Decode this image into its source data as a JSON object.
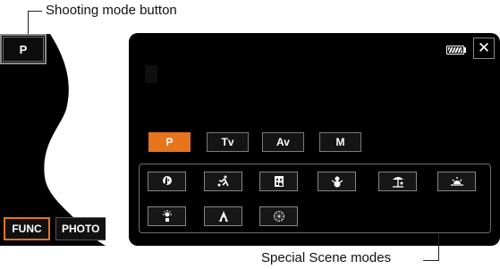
{
  "callouts": {
    "shooting_mode": "Shooting mode button",
    "special_scene": "Special Scene modes"
  },
  "left_panel": {
    "mode_label": "P",
    "func_label": "FUNC",
    "photo_label": "PHOTO"
  },
  "main_screen": {
    "close_label": "✕",
    "modes": [
      {
        "label": "P",
        "active": true
      },
      {
        "label": "Tv",
        "active": false
      },
      {
        "label": "Av",
        "active": false
      },
      {
        "label": "M",
        "active": false
      }
    ],
    "scene_icons": [
      "portrait-icon",
      "sports-icon",
      "night-scene-icon",
      "snow-icon",
      "beach-icon",
      "sunset-icon",
      "low-light-icon",
      "fireworks-icon",
      "spotlight-icon"
    ]
  },
  "colors": {
    "accent": "#e8741b",
    "screen_bg": "#000000"
  }
}
